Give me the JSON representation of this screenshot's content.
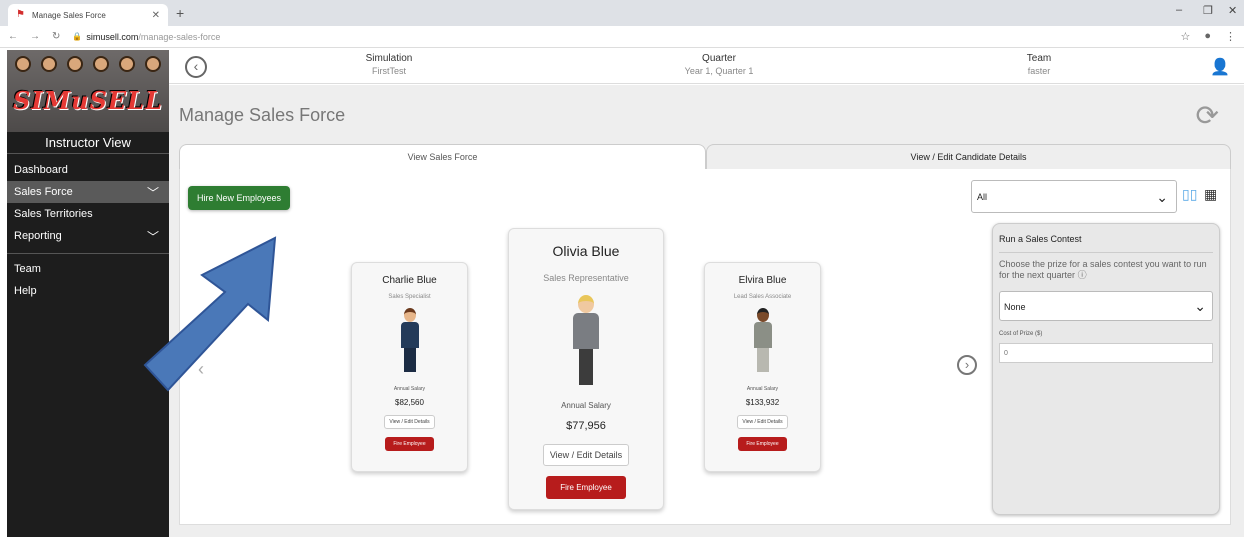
{
  "browser": {
    "tab_title": "Manage Sales Force",
    "url_host": "simusell.com",
    "url_path": "/manage-sales-force"
  },
  "sidebar": {
    "logo_text": "SIMuSELL",
    "view_label": "Instructor View",
    "items": [
      {
        "label": "Dashboard"
      },
      {
        "label": "Sales Force",
        "has_chevron": true,
        "active": true
      },
      {
        "label": "Sales Territories"
      },
      {
        "label": "Reporting",
        "has_chevron": true
      },
      {
        "label": "Team"
      },
      {
        "label": "Help"
      }
    ]
  },
  "topbar": {
    "simulation_label": "Simulation",
    "simulation_value": "FirstTest",
    "quarter_label": "Quarter",
    "quarter_value": "Year 1, Quarter 1",
    "team_label": "Team",
    "team_value": "faster"
  },
  "page": {
    "title": "Manage Sales Force",
    "tabs": [
      {
        "label": "View Sales Force",
        "active": true
      },
      {
        "label": "View / Edit Candidate Details",
        "active": false
      }
    ],
    "hire_button": "Hire New Employees",
    "filter_value": "All"
  },
  "employees": [
    {
      "name": "Charlie Blue",
      "role": "Sales Specialist",
      "salary_label": "Annual Salary",
      "salary": "$82,560",
      "details_button": "View / Edit Details",
      "fire_button": "Fire Employee"
    },
    {
      "name": "Olivia Blue",
      "role": "Sales Representative",
      "salary_label": "Annual Salary",
      "salary": "$77,956",
      "details_button": "View / Edit Details",
      "fire_button": "Fire Employee"
    },
    {
      "name": "Elvira Blue",
      "role": "Lead Sales Associate",
      "salary_label": "Annual Salary",
      "salary": "$133,932",
      "details_button": "View / Edit Details",
      "fire_button": "Fire Employee"
    }
  ],
  "contest": {
    "title": "Run a Sales Contest",
    "description": "Choose the prize for a sales contest you want to run for the next quarter",
    "prize_value": "None",
    "cost_label": "Cost of Prize ($)",
    "cost_placeholder": "0"
  },
  "colors": {
    "hire_green": "#2e7d32",
    "fire_red": "#b71c1c",
    "arrow_blue": "#4a78b8",
    "sidebar_bg": "#1d1d1d"
  }
}
